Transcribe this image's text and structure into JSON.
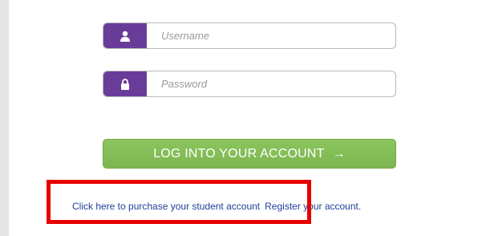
{
  "login_form": {
    "username": {
      "icon": "user-icon",
      "placeholder": "Username",
      "value": ""
    },
    "password": {
      "icon": "lock-icon",
      "placeholder": "Password",
      "value": ""
    },
    "submit_label": "LOG INTO YOUR ACCOUNT",
    "submit_arrow": "→"
  },
  "links": {
    "purchase": "Click here to purchase your student account",
    "register": "Register your account."
  },
  "colors": {
    "addon_purple": "#6a3c99",
    "button_green": "#7db650",
    "link_blue": "#1f3f9a",
    "highlight_red": "#e60000"
  }
}
